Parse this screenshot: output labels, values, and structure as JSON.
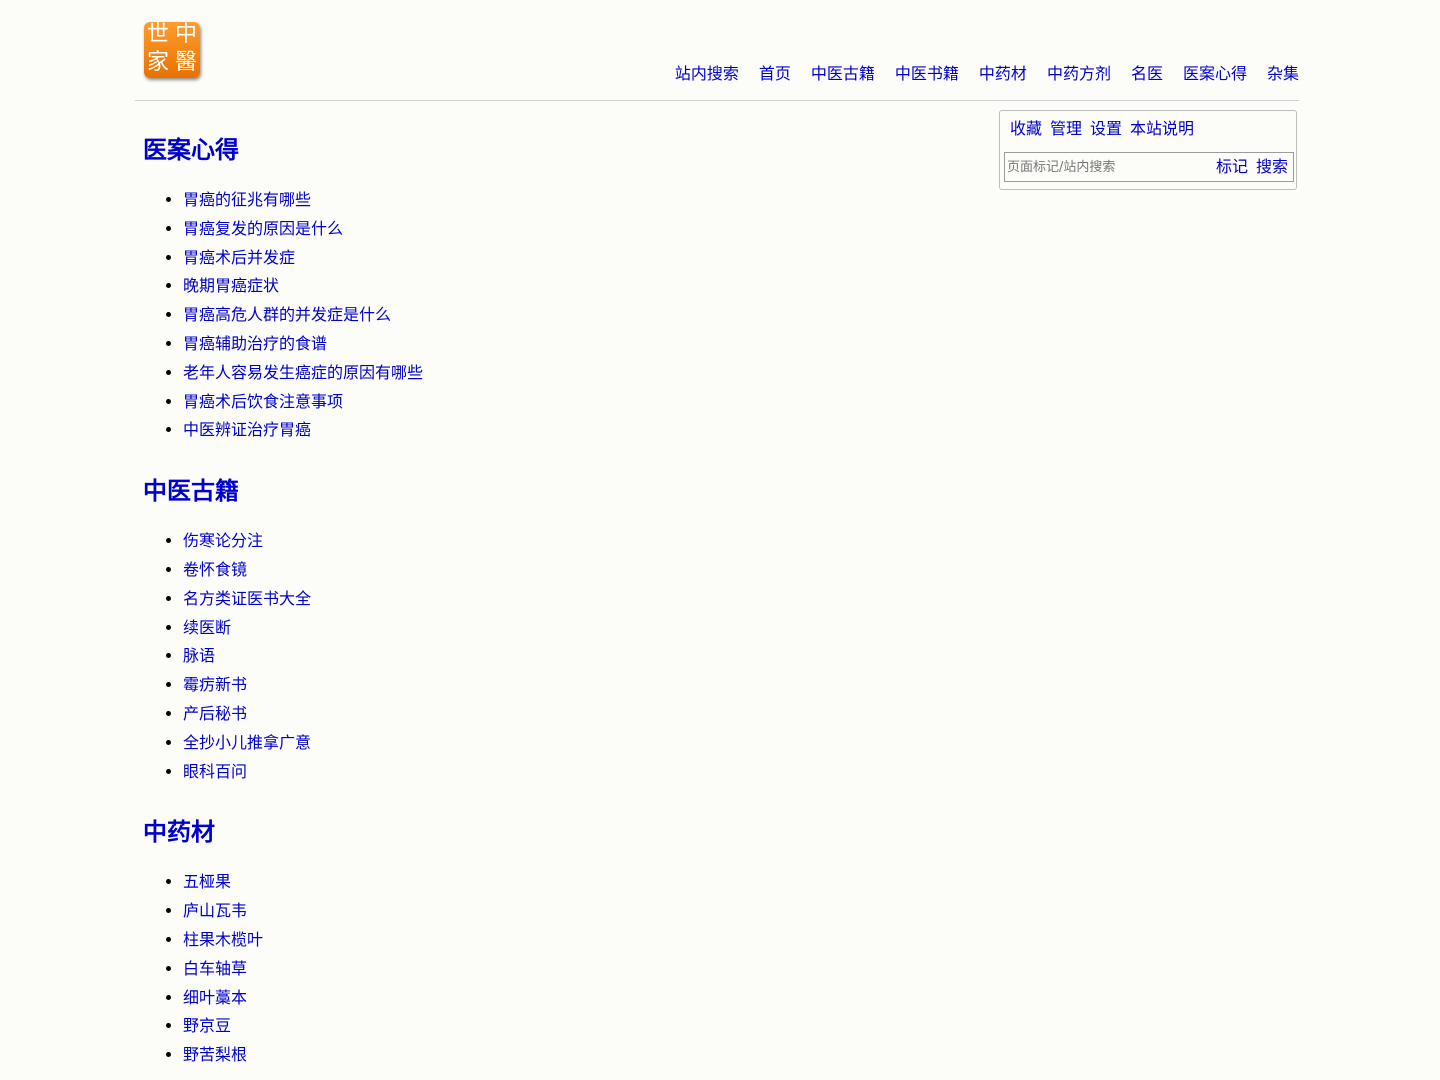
{
  "logo": {
    "chars": [
      "世",
      "中",
      "家",
      "醫"
    ]
  },
  "nav": [
    "站内搜索",
    "首页",
    "中医古籍",
    "中医书籍",
    "中药材",
    "中药方剂",
    "名医",
    "医案心得",
    "杂集"
  ],
  "side": {
    "links": [
      "收藏",
      "管理",
      "设置",
      "本站说明"
    ],
    "search_placeholder": "页面标记/站内搜索",
    "mark_label": "标记",
    "search_label": "搜索"
  },
  "sections": [
    {
      "title": "医案心得",
      "items": [
        "胃癌的征兆有哪些",
        "胃癌复发的原因是什么",
        "胃癌术后并发症",
        "晚期胃癌症状",
        "胃癌高危人群的并发症是什么",
        "胃癌辅助治疗的食谱",
        "老年人容易发生癌症的原因有哪些",
        "胃癌术后饮食注意事项",
        "中医辨证治疗胃癌"
      ]
    },
    {
      "title": "中医古籍",
      "items": [
        "伤寒论分注",
        "卷怀食镜",
        "名方类证医书大全",
        "续医断",
        "脉语",
        "霉疠新书",
        "产后秘书",
        "全抄小儿推拿广意",
        "眼科百问"
      ]
    },
    {
      "title": "中药材",
      "items": [
        "五桠果",
        "庐山瓦韦",
        "柱果木榄叶",
        "白车轴草",
        "细叶藁本",
        "野京豆",
        "野苦梨根"
      ]
    }
  ]
}
